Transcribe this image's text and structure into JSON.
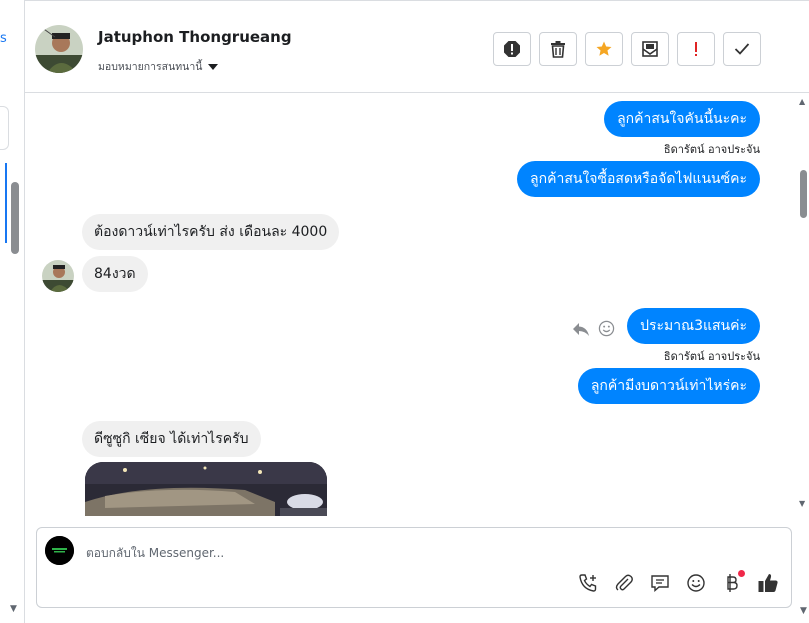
{
  "left_pane": {
    "fragment": "s"
  },
  "header": {
    "contact_name": "Jatuphon Thongrueang",
    "assign_label": "มอบหมายการสนทนานี้"
  },
  "messages": {
    "out1": "ลูกค้าสนใจคันนี้นะคะ",
    "out1_sender": "ธิดารัตน์ อาจประจัน",
    "out2": "ลูกค้าสนใจซื้อสดหรือจัดไฟแนนซ์คะ",
    "in1": "ต้องดาวน์เท่าไรครับ ส่ง เดือนละ 4000",
    "in2": "84งวด",
    "out3": "ประมาณ3แสนค่ะ",
    "out3_sender": "ธิดารัตน์ อาจประจัน",
    "out4": "ลูกค้ามีงบดาวน์เท่าไหร่คะ",
    "in3": "ดีซูซูกิ เซียจ ได้เท่าไรครับ"
  },
  "composer": {
    "placeholder": "ตอบกลับใน Messenger..."
  },
  "icons": {
    "spam": "exclamation-octagon-icon",
    "trash": "trash-icon",
    "star": "star-icon",
    "mark_unread": "envelope-icon",
    "important": "exclamation-icon",
    "done": "check-icon",
    "reply": "reply-icon",
    "react": "smiley-icon",
    "call": "call-add-icon",
    "attach": "paperclip-icon",
    "saved_reply": "saved-reply-icon",
    "emoji": "emoji-icon",
    "payment": "baht-payment-icon",
    "like": "thumbs-up-icon"
  },
  "colors": {
    "outgoing_bubble": "#0084ff",
    "incoming_bubble": "#f0f0f0",
    "star": "#f5a623",
    "important": "#e02424",
    "notification_dot": "#f02849",
    "accent": "#1877f2"
  }
}
